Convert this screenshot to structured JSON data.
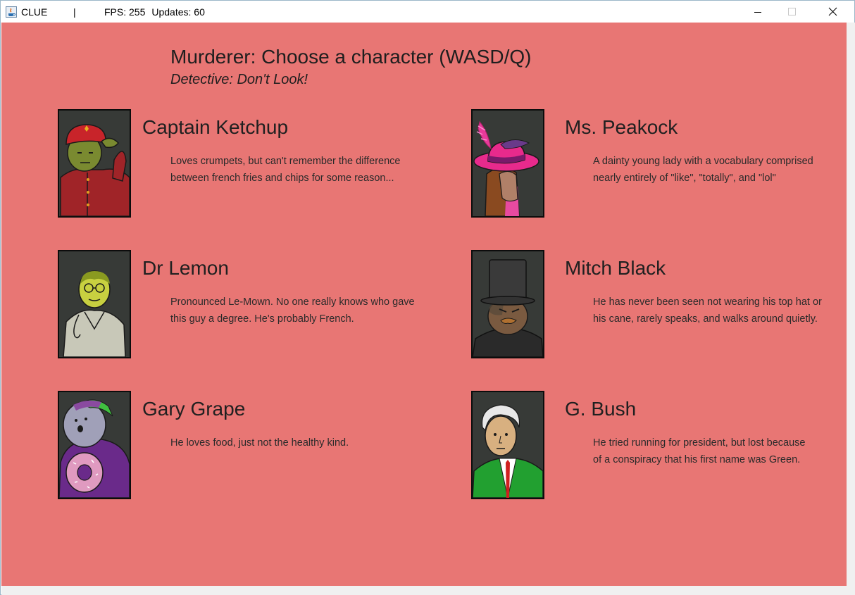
{
  "window": {
    "title": "CLUE",
    "separator": "|",
    "fps_label": "FPS: 255",
    "updates_label": "Updates: 60"
  },
  "screen": {
    "heading": "Murderer: Choose a character (WASD/Q)",
    "subheading": "Detective: Don't Look!",
    "background_color": "#e87674"
  },
  "characters": [
    {
      "name": "Captain Ketchup",
      "portrait_icon": "captain-ketchup-portrait",
      "desc_lines": [
        "Loves crumpets, but can't remember the difference",
        "between french fries and chips for some reason..."
      ]
    },
    {
      "name": "Ms. Peakock",
      "portrait_icon": "ms-peakock-portrait",
      "desc_lines": [
        "A dainty young lady with a vocabulary comprised",
        "nearly entirely of \"like\", \"totally\", and \"lol\""
      ]
    },
    {
      "name": "Dr Lemon",
      "portrait_icon": "dr-lemon-portrait",
      "desc_lines": [
        "Pronounced Le-Mown. No one really knows who gave",
        "this guy a degree. He's probably French."
      ]
    },
    {
      "name": "Mitch Black",
      "portrait_icon": "mitch-black-portrait",
      "desc_lines": [
        "He has never been seen not wearing his top hat or",
        "his cane, rarely speaks, and walks around quietly."
      ]
    },
    {
      "name": "Gary Grape",
      "portrait_icon": "gary-grape-portrait",
      "desc_lines": [
        "He loves food, just not the healthy kind."
      ]
    },
    {
      "name": "G. Bush",
      "portrait_icon": "g-bush-portrait",
      "desc_lines": [
        "He tried running for president, but lost because",
        "of a conspiracy that his first name was Green."
      ]
    }
  ]
}
